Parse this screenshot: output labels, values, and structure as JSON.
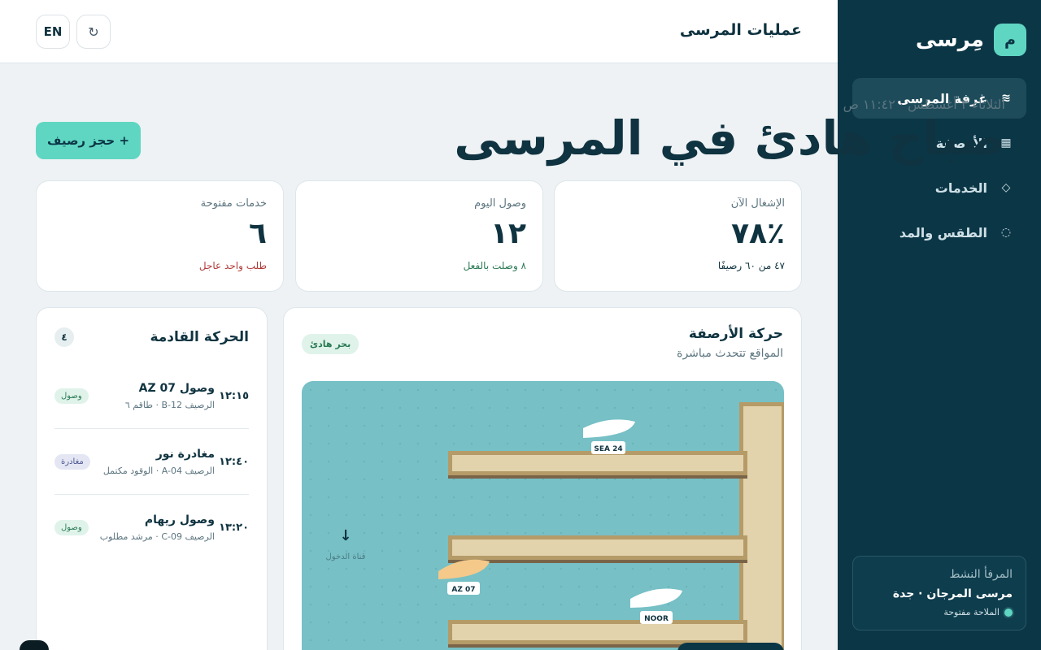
{
  "sidebar": {
    "logo_letter": "م",
    "brand": "مِرسى",
    "items": [
      {
        "label": "غرفة المرسى",
        "icon": "≋"
      },
      {
        "label": "الأرصفة",
        "icon": "▦"
      },
      {
        "label": "الخدمات",
        "icon": "◇"
      },
      {
        "label": "الطقس والمد",
        "icon": "◌"
      }
    ],
    "facility": {
      "label": "المرفأ النشط",
      "name": "مرسى المرجان · جدة",
      "status": "الملاحة مفتوحة"
    }
  },
  "topbar": {
    "title": "عمليات المرسى",
    "lang": "EN",
    "refresh_icon": "↻"
  },
  "hero": {
    "date": "الثلاثاء ٣ أغسطس · ١١:٤٢ ص",
    "title": "صباح هادئ في المرسى",
    "book_button": "+ حجز رصيف"
  },
  "stats": [
    {
      "label": "الإشغال الآن",
      "value": "٪٧٨",
      "note": "٤٧ من ٦٠ رصيفًا",
      "note_color": "#0f3340"
    },
    {
      "label": "وصول اليوم",
      "value": "١٢",
      "note": "٨ وصلت بالفعل",
      "note_color": "#2b7a55"
    },
    {
      "label": "خدمات مفتوحة",
      "value": "٦",
      "note": "طلب واحد عاجل",
      "note_color": "#b23a3a"
    }
  ],
  "traffic": {
    "title": "الحركة القادمة",
    "count": "٤",
    "items": [
      {
        "time": "١٢:١٥",
        "name": "وصول AZ 07",
        "detail": "الرصيف B-12 · طاقم ٦",
        "tag": "وصول",
        "kind": "arr"
      },
      {
        "time": "١٢:٤٠",
        "name": "مغادرة نور",
        "detail": "الرصيف A-04 · الوقود مكتمل",
        "tag": "مغادرة",
        "kind": "dep"
      },
      {
        "time": "١٣:٢٠",
        "name": "وصول ريهام",
        "detail": "الرصيف C-09 · مرشد مطلوب",
        "tag": "وصول",
        "kind": "arr"
      }
    ]
  },
  "berths": {
    "title": "حركة الأرصفة",
    "subtitle": "المواقع تتحدث مباشرة",
    "sea_state": "بحر هادئ",
    "entry_label": "قناة الدخول",
    "entry_icon": "↓",
    "boats": [
      {
        "label": "SEA 24",
        "color": "#ffffff"
      },
      {
        "label": "AZ 07",
        "color": "#f4c98a"
      },
      {
        "label": "NOOR",
        "color": "#ffffff"
      }
    ]
  }
}
